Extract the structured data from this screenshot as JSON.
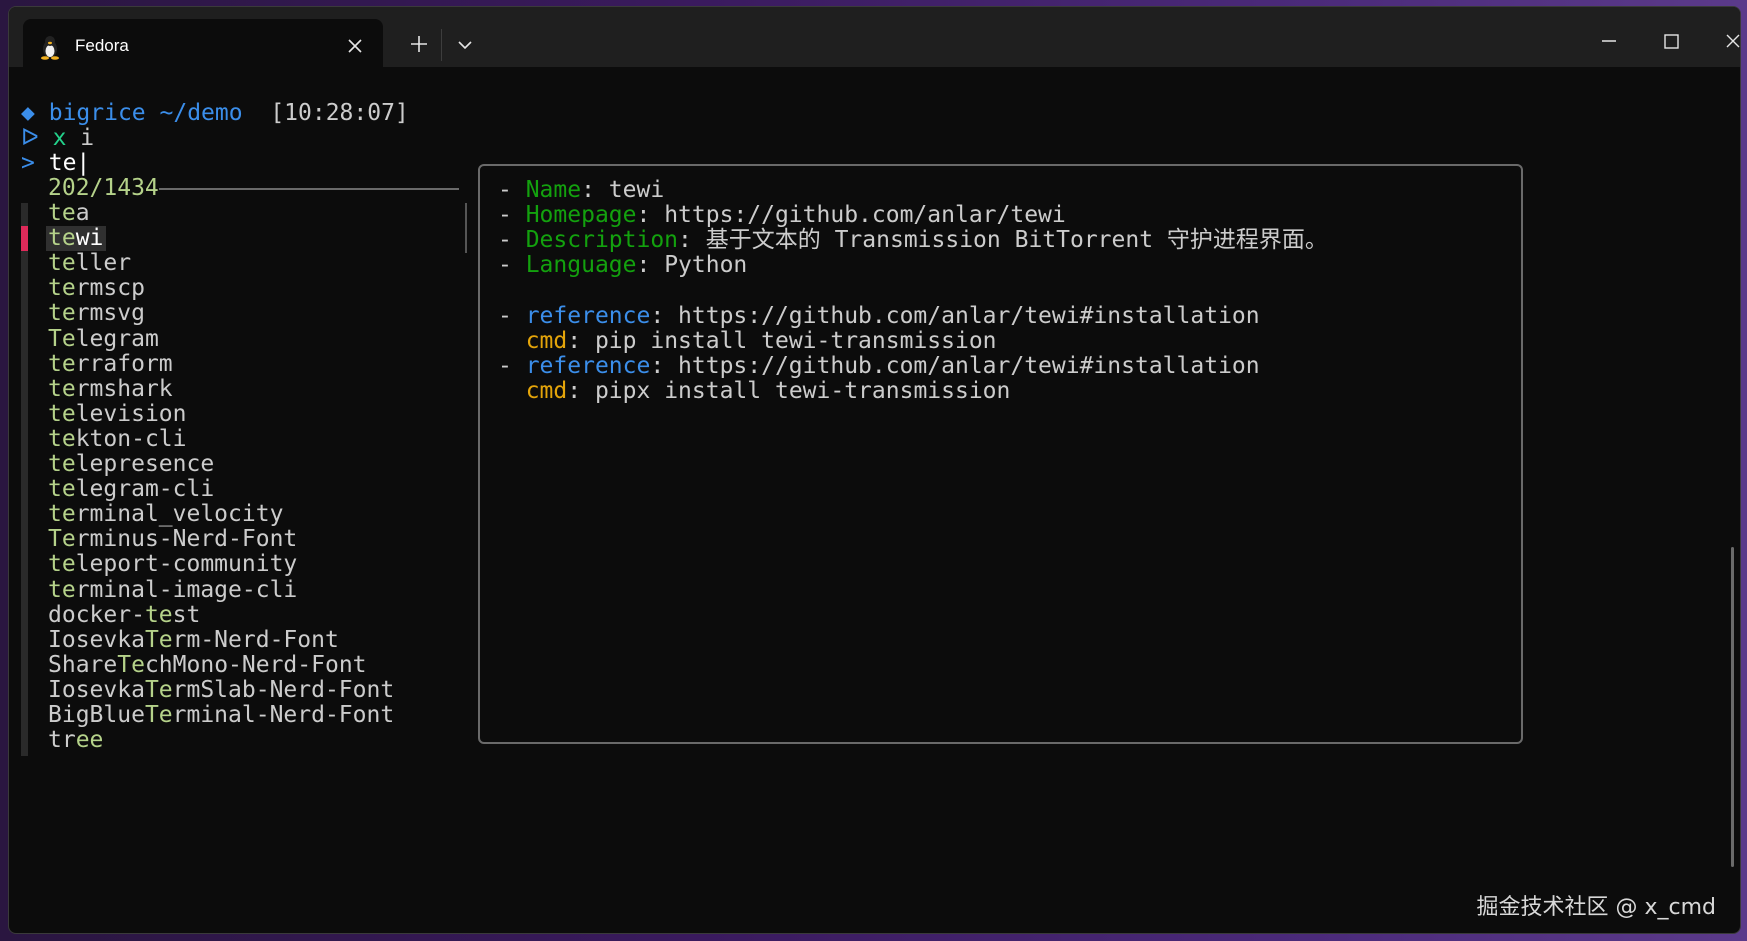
{
  "window": {
    "tab_title": "Fedora",
    "tab_icon": "tux-penguin-icon"
  },
  "terminal": {
    "prompt": {
      "diamond": "◆",
      "user": "bigrice",
      "path": "~/demo",
      "time": "[10:28:07]"
    },
    "command": {
      "arrow": "ᐅ",
      "cmd": "x",
      "arg": "i"
    },
    "query": {
      "symbol": ">",
      "text": "te"
    },
    "counter": "202/1434",
    "items": [
      {
        "pre": "",
        "m": "te",
        "post": "a"
      },
      {
        "pre": "",
        "m": "te",
        "post": "wi"
      },
      {
        "pre": "",
        "m": "te",
        "post": "ller"
      },
      {
        "pre": "",
        "m": "te",
        "post": "rmscp"
      },
      {
        "pre": "",
        "m": "te",
        "post": "rmsvg"
      },
      {
        "pre": "",
        "m": "Te",
        "post": "legram"
      },
      {
        "pre": "",
        "m": "te",
        "post": "rraform"
      },
      {
        "pre": "",
        "m": "te",
        "post": "rmshark"
      },
      {
        "pre": "",
        "m": "te",
        "post": "levision"
      },
      {
        "pre": "",
        "m": "te",
        "post": "kton-cli"
      },
      {
        "pre": "",
        "m": "te",
        "post": "lepresence"
      },
      {
        "pre": "",
        "m": "te",
        "post": "legram-cli"
      },
      {
        "pre": "",
        "m": "te",
        "post": "rminal_velocity"
      },
      {
        "pre": "",
        "m": "Te",
        "post": "rminus-Nerd-Font"
      },
      {
        "pre": "",
        "m": "te",
        "post": "leport-community"
      },
      {
        "pre": "",
        "m": "te",
        "post": "rminal-image-cli"
      },
      {
        "pre": "docker-",
        "m": "te",
        "post": "st"
      },
      {
        "pre": "Iosevka",
        "m": "Te",
        "post": "rm-Nerd-Font"
      },
      {
        "pre": "Share",
        "m": "Te",
        "post": "chMono-Nerd-Font"
      },
      {
        "pre": "Iosevka",
        "m": "Te",
        "post": "rmSlab-Nerd-Font"
      },
      {
        "pre": "BigBlue",
        "m": "Te",
        "post": "rminal-Nerd-Font"
      },
      {
        "pre": "tr",
        "m": "ee",
        "post": ""
      }
    ],
    "selected_index": 1
  },
  "preview": {
    "lines": [
      {
        "bullet": "- ",
        "key": "Name",
        "key_color": "green",
        "sep": ": ",
        "val": "tewi"
      },
      {
        "bullet": "- ",
        "key": "Homepage",
        "key_color": "green",
        "sep": ": ",
        "val": "https://github.com/anlar/tewi"
      },
      {
        "bullet": "- ",
        "key": "Description",
        "key_color": "green",
        "sep": ": ",
        "val": "基于文本的 Transmission BitTorrent 守护进程界面。"
      },
      {
        "bullet": "- ",
        "key": "Language",
        "key_color": "green",
        "sep": ": ",
        "val": "Python"
      },
      {
        "bullet": "",
        "key": "",
        "key_color": "green",
        "sep": "",
        "val": ""
      },
      {
        "bullet": "- ",
        "key": "reference",
        "key_color": "blue",
        "sep": ": ",
        "val": "https://github.com/anlar/tewi#installation"
      },
      {
        "bullet": "  ",
        "key": "cmd",
        "key_color": "yellow",
        "sep": ": ",
        "val": "pip install tewi-transmission"
      },
      {
        "bullet": "- ",
        "key": "reference",
        "key_color": "blue",
        "sep": ": ",
        "val": "https://github.com/anlar/tewi#installation"
      },
      {
        "bullet": "  ",
        "key": "cmd",
        "key_color": "yellow",
        "sep": ": ",
        "val": "pipx install tewi-transmission"
      }
    ]
  },
  "watermark": "掘金技术社区 @ x_cmd",
  "colors": {
    "match": "#b5d28a",
    "selected_marker": "#e02a5a",
    "prompt_blue": "#3b8eea",
    "key_green": "#13a10e",
    "key_yellow": "#e5a50a"
  }
}
